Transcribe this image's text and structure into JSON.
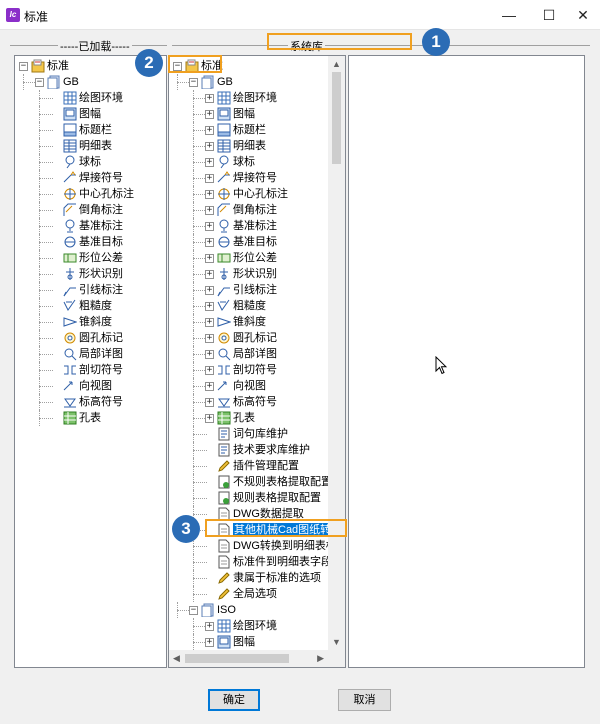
{
  "window": {
    "title": "标准",
    "app_icon_letter": "Ic",
    "minimize": "—",
    "maximize": "☐",
    "close": "✕"
  },
  "groups": {
    "loaded": "-----已加载-----",
    "system": "系统库"
  },
  "callouts": [
    "1",
    "2",
    "3"
  ],
  "left_tree": [
    {
      "label": "标准",
      "level": 0,
      "icon": "book-folder-icon",
      "expander": "⊟"
    },
    {
      "label": "GB",
      "level": 1,
      "icon": "document-stack-icon",
      "expander": "⊟"
    },
    {
      "label": "绘图环境",
      "level": 2,
      "icon": "grid-icon"
    },
    {
      "label": "图幅",
      "level": 2,
      "icon": "frame-icon"
    },
    {
      "label": "标题栏",
      "level": 2,
      "icon": "titlebar-icon"
    },
    {
      "label": "明细表",
      "level": 2,
      "icon": "table-icon"
    },
    {
      "label": "球标",
      "level": 2,
      "icon": "balloon-icon"
    },
    {
      "label": "焊接符号",
      "level": 2,
      "icon": "weld-icon"
    },
    {
      "label": "中心孔标注",
      "level": 2,
      "icon": "center-hole-icon"
    },
    {
      "label": "倒角标注",
      "level": 2,
      "icon": "chamfer-icon"
    },
    {
      "label": "基准标注",
      "level": 2,
      "icon": "datum-icon"
    },
    {
      "label": "基准目标",
      "level": 2,
      "icon": "datum-target-icon"
    },
    {
      "label": "形位公差",
      "level": 2,
      "icon": "tolerance-icon"
    },
    {
      "label": "形状识别",
      "level": 2,
      "icon": "shape-icon"
    },
    {
      "label": "引线标注",
      "level": 2,
      "icon": "leader-icon"
    },
    {
      "label": "粗糙度",
      "level": 2,
      "icon": "roughness-icon"
    },
    {
      "label": "锥斜度",
      "level": 2,
      "icon": "taper-icon"
    },
    {
      "label": "圆孔标记",
      "level": 2,
      "icon": "hole-mark-icon"
    },
    {
      "label": "局部详图",
      "level": 2,
      "icon": "detail-icon"
    },
    {
      "label": "剖切符号",
      "level": 2,
      "icon": "section-icon"
    },
    {
      "label": "向视图",
      "level": 2,
      "icon": "view-icon"
    },
    {
      "label": "标高符号",
      "level": 2,
      "icon": "elevation-icon"
    },
    {
      "label": "孔表",
      "level": 2,
      "icon": "hole-table-icon"
    }
  ],
  "middle_tree": [
    {
      "label": "标准",
      "level": 0,
      "icon": "book-folder-icon",
      "expander": "⊟"
    },
    {
      "label": "GB",
      "level": 1,
      "icon": "document-stack-icon",
      "expander": "⊟"
    },
    {
      "label": "绘图环境",
      "level": 2,
      "icon": "grid-icon",
      "expander": "⊞"
    },
    {
      "label": "图幅",
      "level": 2,
      "icon": "frame-icon",
      "expander": "⊞"
    },
    {
      "label": "标题栏",
      "level": 2,
      "icon": "titlebar-icon",
      "expander": "⊞"
    },
    {
      "label": "明细表",
      "level": 2,
      "icon": "table-icon",
      "expander": "⊞"
    },
    {
      "label": "球标",
      "level": 2,
      "icon": "balloon-icon",
      "expander": "⊞"
    },
    {
      "label": "焊接符号",
      "level": 2,
      "icon": "weld-icon",
      "expander": "⊞"
    },
    {
      "label": "中心孔标注",
      "level": 2,
      "icon": "center-hole-icon",
      "expander": "⊞"
    },
    {
      "label": "倒角标注",
      "level": 2,
      "icon": "chamfer-icon",
      "expander": "⊞"
    },
    {
      "label": "基准标注",
      "level": 2,
      "icon": "datum-icon",
      "expander": "⊞"
    },
    {
      "label": "基准目标",
      "level": 2,
      "icon": "datum-target-icon",
      "expander": "⊞"
    },
    {
      "label": "形位公差",
      "level": 2,
      "icon": "tolerance-icon",
      "expander": "⊞"
    },
    {
      "label": "形状识别",
      "level": 2,
      "icon": "shape-icon",
      "expander": "⊞"
    },
    {
      "label": "引线标注",
      "level": 2,
      "icon": "leader-icon",
      "expander": "⊞"
    },
    {
      "label": "粗糙度",
      "level": 2,
      "icon": "roughness-icon",
      "expander": "⊞"
    },
    {
      "label": "锥斜度",
      "level": 2,
      "icon": "taper-icon",
      "expander": "⊞"
    },
    {
      "label": "圆孔标记",
      "level": 2,
      "icon": "hole-mark-icon",
      "expander": "⊞"
    },
    {
      "label": "局部详图",
      "level": 2,
      "icon": "detail-icon",
      "expander": "⊞"
    },
    {
      "label": "剖切符号",
      "level": 2,
      "icon": "section-icon",
      "expander": "⊞"
    },
    {
      "label": "向视图",
      "level": 2,
      "icon": "view-icon",
      "expander": "⊞"
    },
    {
      "label": "标高符号",
      "level": 2,
      "icon": "elevation-icon",
      "expander": "⊞"
    },
    {
      "label": "孔表",
      "level": 2,
      "icon": "hole-table-icon",
      "expander": "⊞"
    },
    {
      "label": "词句库维护",
      "level": 2,
      "icon": "dictionary-icon"
    },
    {
      "label": "技术要求库维护",
      "level": 2,
      "icon": "dictionary-icon"
    },
    {
      "label": "插件管理配置",
      "level": 2,
      "icon": "pencil-icon"
    },
    {
      "label": "不规则表格提取配置",
      "level": 2,
      "icon": "sheet-gear-icon"
    },
    {
      "label": "规则表格提取配置",
      "level": 2,
      "icon": "sheet-gear-icon"
    },
    {
      "label": "DWG数据提取",
      "level": 2,
      "icon": "document-icon"
    },
    {
      "label": "其他机械Cad图纸转换字段映",
      "level": 2,
      "icon": "document-icon",
      "selected": true
    },
    {
      "label": "DWG转换到明细表标题栏字",
      "level": 2,
      "icon": "document-icon"
    },
    {
      "label": "标准件到明细表字段映射配",
      "level": 2,
      "icon": "document-icon"
    },
    {
      "label": "隶属于标准的选项",
      "level": 2,
      "icon": "pencil-icon"
    },
    {
      "label": "全局选项",
      "level": 2,
      "icon": "pencil-icon"
    },
    {
      "label": "ISO",
      "level": 1,
      "icon": "document-stack-icon",
      "expander": "⊟"
    },
    {
      "label": "绘图环境",
      "level": 2,
      "icon": "grid-icon",
      "expander": "⊞"
    },
    {
      "label": "图幅",
      "level": 2,
      "icon": "frame-icon",
      "expander": "⊞"
    }
  ],
  "buttons": {
    "ok": "确定",
    "cancel": "取消"
  },
  "colors": {
    "accent": "#0078d7",
    "callout": "#2b6cb5",
    "highlight_box": "#f0a020"
  }
}
